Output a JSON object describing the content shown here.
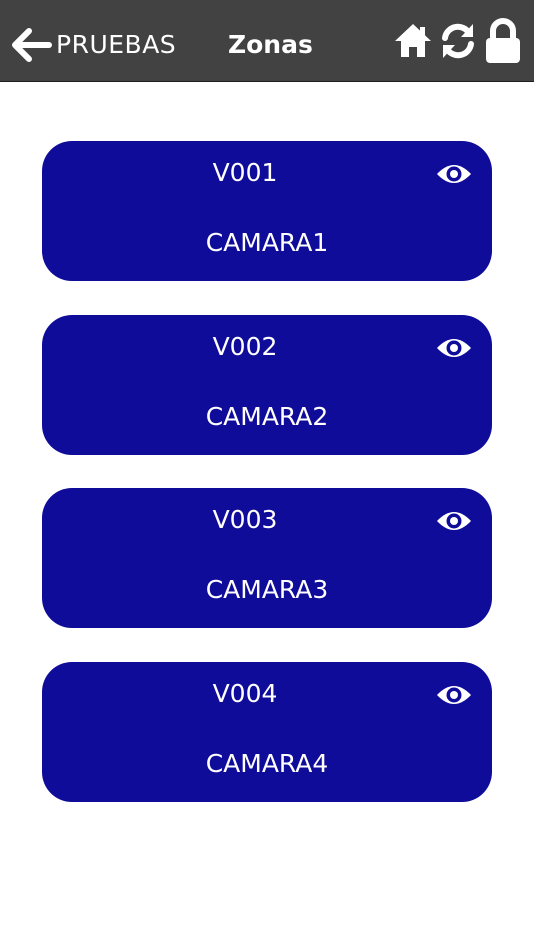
{
  "header": {
    "back_label": "PRUEBAS",
    "title": "Zonas",
    "icons": [
      "arrow-left-icon",
      "home-icon",
      "refresh-icon",
      "lock-icon"
    ],
    "background": "#424242"
  },
  "zones": [
    {
      "code": "V001",
      "name": "CAMARA1"
    },
    {
      "code": "V002",
      "name": "CAMARA2"
    },
    {
      "code": "V003",
      "name": "CAMARA3"
    },
    {
      "code": "V004",
      "name": "CAMARA4"
    }
  ],
  "colors": {
    "card": "#100c9a",
    "text": "#ffffff"
  }
}
